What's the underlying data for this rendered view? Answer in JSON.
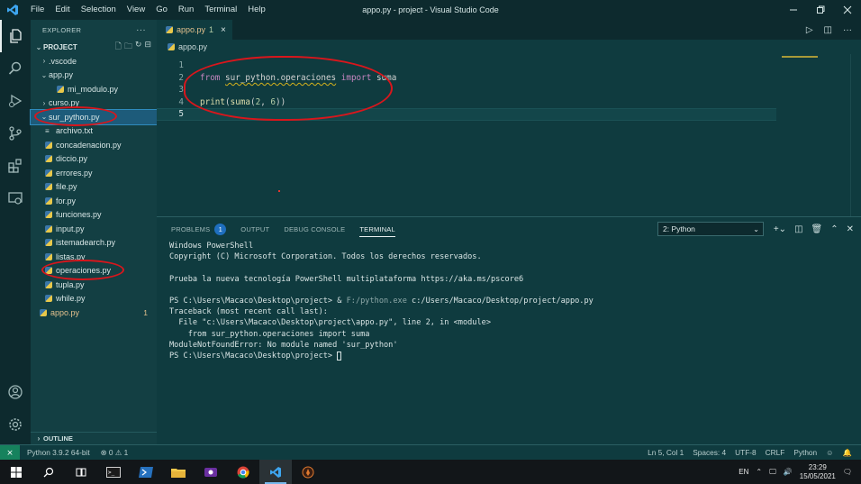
{
  "window": {
    "title": "appo.py - project - Visual Studio Code",
    "menu": [
      "File",
      "Edit",
      "Selection",
      "View",
      "Go",
      "Run",
      "Terminal",
      "Help"
    ]
  },
  "activity_bar": [
    "files-icon",
    "search-icon",
    "run-debug-icon",
    "source-control-icon",
    "extensions-icon",
    "remote-explorer-icon",
    "account-icon",
    "settings-icon"
  ],
  "explorer": {
    "header": "EXPLORER",
    "project": "PROJECT",
    "items": [
      {
        "label": ".vscode",
        "type": "folder"
      },
      {
        "label": "app.py",
        "type": "folder"
      },
      {
        "label": "mi_modulo.py",
        "type": "py"
      },
      {
        "label": "curso.py",
        "type": "folder"
      },
      {
        "label": "sur_python.py",
        "type": "folder"
      },
      {
        "label": "archivo.txt",
        "type": "txt"
      },
      {
        "label": "concadenacion.py",
        "type": "py"
      },
      {
        "label": "diccio.py",
        "type": "py"
      },
      {
        "label": "errores.py",
        "type": "py"
      },
      {
        "label": "file.py",
        "type": "py"
      },
      {
        "label": "for.py",
        "type": "py"
      },
      {
        "label": "funciones.py",
        "type": "py"
      },
      {
        "label": "input.py",
        "type": "py"
      },
      {
        "label": "istemadearch.py",
        "type": "py"
      },
      {
        "label": "listas.py",
        "type": "py"
      },
      {
        "label": "operaciones.py",
        "type": "py"
      },
      {
        "label": "tupla.py",
        "type": "py"
      },
      {
        "label": "while.py",
        "type": "py"
      },
      {
        "label": "appo.py",
        "type": "py",
        "badge": "1"
      }
    ],
    "outline": "OUTLINE"
  },
  "editor": {
    "tab": {
      "label": "appo.py",
      "problems": "1",
      "close": "×"
    },
    "breadcrumb": "appo.py",
    "lines": [
      "1",
      "2",
      "3",
      "4",
      "5"
    ],
    "code": {
      "from": "from",
      "module": "sur_python.operaciones",
      "import": "import",
      "name": "suma",
      "print": "print",
      "call_open": "(",
      "suma": "suma",
      "args_open": "(",
      "a": "2",
      "comma": ", ",
      "b": "6",
      "close": "))"
    }
  },
  "panel": {
    "tabs": [
      "PROBLEMS",
      "OUTPUT",
      "DEBUG CONSOLE",
      "TERMINAL"
    ],
    "problems_count": "1",
    "terminal_select": "2: Python",
    "terminal": {
      "l1": "Windows PowerShell",
      "l2": "Copyright (C) Microsoft Corporation. Todos los derechos reservados.",
      "l3": "Prueba la nueva tecnología PowerShell multiplataforma https://aka.ms/pscore6",
      "l4_prompt": "PS C:\\Users\\Macaco\\Desktop\\project> & ",
      "l4_exe": "F:/python.exe",
      "l4_arg": " c:/Users/Macaco/Desktop/project/appo.py",
      "l5": "Traceback (most recent call last):",
      "l6": "  File \"c:\\Users\\Macaco\\Desktop\\project\\appo.py\", line 2, in <module>",
      "l7": "    from sur_python.operaciones import suma",
      "l8": "ModuleNotFoundError: No module named 'sur_python'",
      "l9": "PS C:\\Users\\Macaco\\Desktop\\project> "
    }
  },
  "statusbar": {
    "interpreter": "Python 3.9.2 64-bit",
    "problems": "⊗ 0 ⚠ 1",
    "position": "Ln 5, Col 1",
    "spaces": "Spaces: 4",
    "encoding": "UTF-8",
    "eol": "CRLF",
    "language": "Python"
  },
  "taskbar": {
    "lang": "EN",
    "time": "23:29",
    "date": "15/05/2021"
  },
  "colors": {
    "accent": "#1f6fbf",
    "background": "#0f3b3f",
    "annotation": "#d9161c"
  }
}
